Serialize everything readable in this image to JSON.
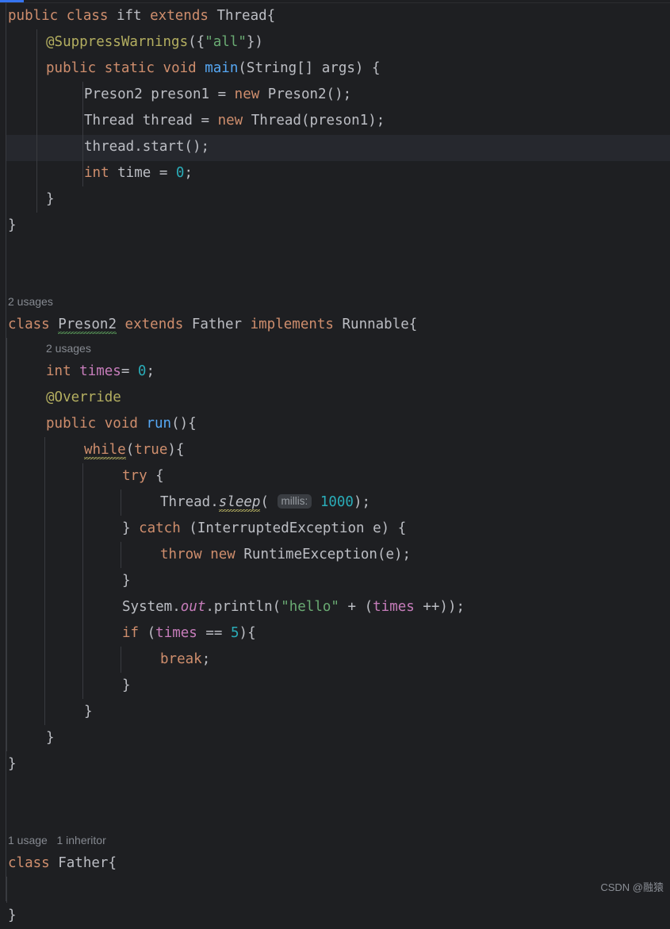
{
  "editor": {
    "theme": "IntelliJ New Dark",
    "background": "#1e1f22",
    "gutter_border": "#393b40",
    "current_line_bg": "#26282e",
    "tab_indicator_color": "#3574f0",
    "current_line_number": 6,
    "colors": {
      "keyword": "#cf8e6d",
      "default_text": "#bcbec4",
      "string": "#6aab73",
      "number": "#2aacb8",
      "annotation": "#b3ae60",
      "method_declaration": "#56a8f5",
      "field": "#c77dbb",
      "hint_text": "#868a91",
      "inlay_bg": "#3a3d42",
      "typo_squiggle": "#5a9b5a",
      "warning_squiggle": "#b3ae60"
    }
  },
  "code": {
    "line1": {
      "t1": "public",
      "t2": " ",
      "t3": "class",
      "t4": " ift ",
      "t5": "extends",
      "t6": " Thread{"
    },
    "line2": {
      "t1": "@SuppressWarnings",
      "t2": "({",
      "t3": "\"all\"",
      "t4": "})"
    },
    "line3": {
      "t1": "public",
      "t2": " ",
      "t3": "static",
      "t4": " ",
      "t5": "void",
      "t6": " ",
      "t7": "main",
      "t8": "(String[] args) {"
    },
    "line4": {
      "t1": "Preson2 preson1 = ",
      "t2": "new",
      "t3": " Preson2();"
    },
    "line5": {
      "t1": "Thread thread = ",
      "t2": "new",
      "t3": " Thread(preson1);"
    },
    "line6": {
      "t1": "thread.start();"
    },
    "line7": {
      "t1": "int",
      "t2": " time = ",
      "t3": "0",
      "t4": ";"
    },
    "line8": {
      "t1": "}"
    },
    "line9": {
      "t1": "}"
    },
    "hint_usages_preson2": "2 usages",
    "line12": {
      "t1": "class",
      "t2": " ",
      "t3": "Preson2",
      "t4": " ",
      "t5": "extends",
      "t6": " Father ",
      "t7": "implements",
      "t8": " Runnable{"
    },
    "hint_usages_times": "2 usages",
    "line14": {
      "t1": "int",
      "t2": " ",
      "t3": "times",
      "t4": "= ",
      "t5": "0",
      "t6": ";"
    },
    "line15": {
      "t1": "@Override"
    },
    "line16": {
      "t1": "public",
      "t2": " ",
      "t3": "void",
      "t4": " ",
      "t5": "run",
      "t6": "(){"
    },
    "line17": {
      "t1": "while",
      "t2": "(",
      "t3": "true",
      "t4": "){"
    },
    "line18": {
      "t1": "try",
      "t2": " {"
    },
    "line19": {
      "t1": "Thread.",
      "t2": "sleep",
      "t3": "( ",
      "t4": "millis:",
      "t5": " ",
      "t6": "1000",
      "t7": ");"
    },
    "line20": {
      "t1": "} ",
      "t2": "catch",
      "t3": " (InterruptedException e) {"
    },
    "line21": {
      "t1": "throw",
      "t2": " ",
      "t3": "new",
      "t4": " RuntimeException(e);"
    },
    "line22": {
      "t1": "}"
    },
    "line23": {
      "t1": "System.",
      "t2": "out",
      "t3": ".println(",
      "t4": "\"hello\"",
      "t5": " + (",
      "t6": "times",
      "t7": " ++));"
    },
    "line24": {
      "t1": "if",
      "t2": " (",
      "t3": "times",
      "t4": " == ",
      "t5": "5",
      "t6": "){"
    },
    "line25": {
      "t1": "break",
      "t2": ";"
    },
    "line26": {
      "t1": "}"
    },
    "line27": {
      "t1": "}"
    },
    "line28": {
      "t1": "}"
    },
    "line29": {
      "t1": "}"
    },
    "hint_father": "1 usage   1 inheritor",
    "line32": {
      "t1": "class",
      "t2": " Father{"
    },
    "line34": {
      "t1": "}"
    }
  },
  "watermark": {
    "text": "CSDN @融猿"
  }
}
